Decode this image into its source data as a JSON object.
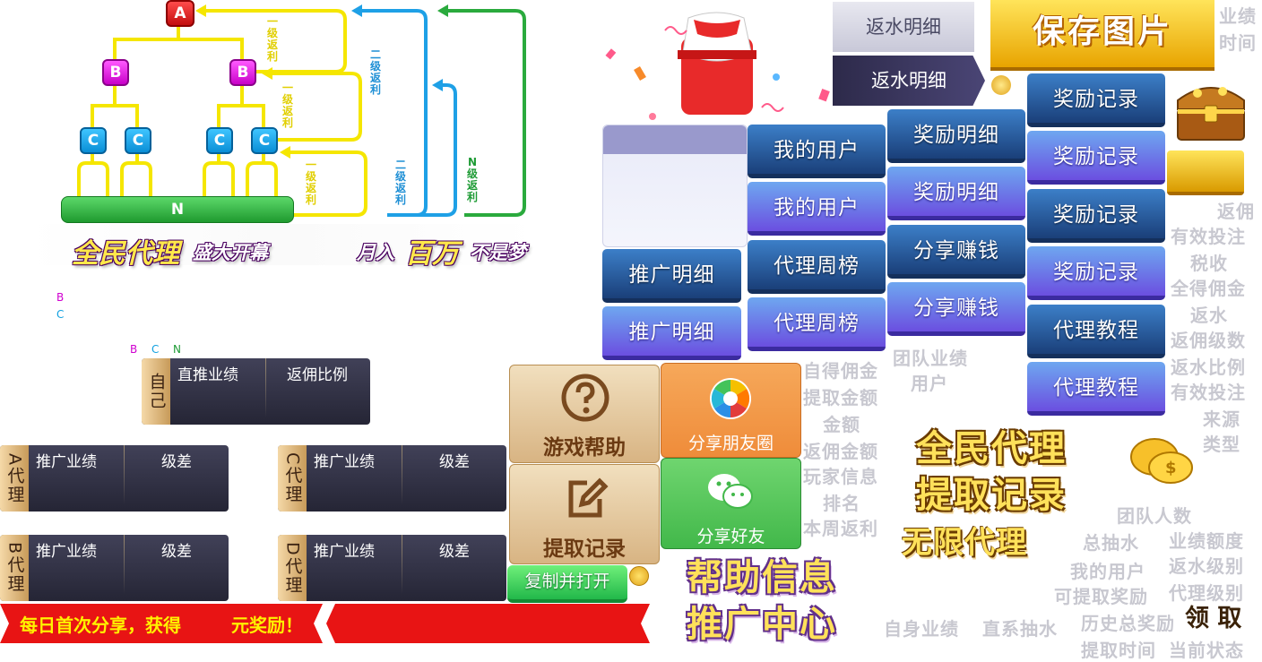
{
  "diagram": {
    "node_a": "A",
    "node_b": "B",
    "node_c": "C",
    "node_n": "N",
    "level1_rebate": "一级返利",
    "level2_rebate": "二级返利",
    "leveln_rebate": "N级返利"
  },
  "banners": {
    "agent_main": "全民代理",
    "agent_sub": "盛大开幕",
    "month_a": "月入",
    "month_b": "百万",
    "month_c": "不是梦"
  },
  "legend": {
    "b": "B",
    "c": "C",
    "bcn_b": "B",
    "bcn_c": "C",
    "bcn_n": "N"
  },
  "tables": {
    "self": {
      "side": "自己",
      "col1": "直推业绩",
      "col2": "返佣比例"
    },
    "a": {
      "side": "A代理",
      "col1": "推广业绩",
      "col2": "级差"
    },
    "b": {
      "side": "B代理",
      "col1": "推广业绩",
      "col2": "级差"
    },
    "c": {
      "side": "C代理",
      "col1": "推广业绩",
      "col2": "级差"
    },
    "d": {
      "side": "D代理",
      "col1": "推广业绩",
      "col2": "级差"
    }
  },
  "red_banner": {
    "left": "每日首次分享，获得",
    "right": "元奖励！"
  },
  "tiles": {
    "game_help": "游戏帮助",
    "withdraw_record": "提取记录",
    "share_moments": "分享朋友圈",
    "share_friends": "分享好友",
    "copy_open": "复制并打开"
  },
  "tabs": {
    "rebate_detail_inactive": "返水明细",
    "rebate_detail_active": "返水明细",
    "save_image": "保存图片"
  },
  "buttons": {
    "promo_detail": "推广明细",
    "my_users": "我的用户",
    "agent_weekly": "代理周榜",
    "reward_detail": "奖励明细",
    "share_earn": "分享赚钱",
    "reward_record": "奖励记录",
    "agent_tutorial": "代理教程"
  },
  "gray_labels": {
    "team_perf_user": [
      "团队业绩",
      "用户"
    ],
    "col_mid": [
      "自得佣金",
      "提取金额",
      "金额",
      "返佣金额",
      "玩家信息",
      "排名",
      "本周返利"
    ],
    "col_right": [
      "返佣",
      "有效投注",
      "税收",
      "全得佣金",
      "返水",
      "返佣级数",
      "返水比例",
      "有效投注",
      "来源",
      "类型"
    ],
    "top_right": [
      "业绩",
      "时间"
    ],
    "team_count": "团队人数",
    "total_draw": "总抽水",
    "perf_quota": "业绩额度",
    "my_users": "我的用户",
    "rebate_level": "返水级别",
    "withdrawable": "可提取奖励",
    "agent_level": "代理级别",
    "self_perf": "自身业绩",
    "direct_draw": "直系抽水",
    "history_total": "历史总奖励",
    "withdraw_time": "提取时间",
    "current_status": "当前状态"
  },
  "big_titles": {
    "agent": "全民代理",
    "withdraw": "提取记录",
    "unlimited": "无限代理",
    "help_info": "帮助信息",
    "promo_center": "推广中心",
    "claim": "领 取"
  },
  "colors": {
    "dark_button": "#1a3f79",
    "light_button": "#6b4fe0",
    "gold": "#ffe15a",
    "red": "#e81414"
  }
}
